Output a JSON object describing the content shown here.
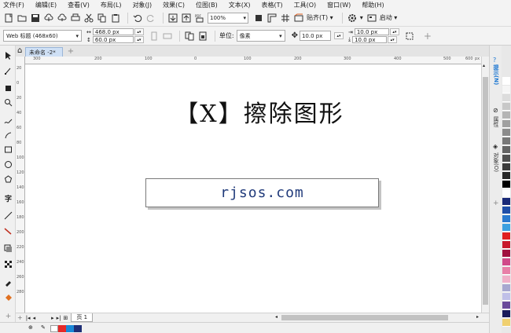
{
  "menu": [
    "文件(F)",
    "编辑(E)",
    "查看(V)",
    "布局(L)",
    "对象(J)",
    "效果(C)",
    "位图(B)",
    "文本(X)",
    "表格(T)",
    "工具(O)",
    "窗口(W)",
    "帮助(H)"
  ],
  "toolbar": {
    "zoom": "100%",
    "snap_label": "贴齐(T)",
    "launch_label": "启动"
  },
  "propbar": {
    "preset": "Web 标题 (468x60)",
    "width": "468.0 px",
    "height": "60.0 px",
    "unit_label": "单位:",
    "unit": "像素",
    "nudge": "10.0 px",
    "dup_x": "10.0 px",
    "dup_y": "10.0 px"
  },
  "tab": {
    "doc_name": "未命名 -2*"
  },
  "ruler": {
    "h_ticks": [
      "300",
      "200",
      "100",
      "0",
      "100",
      "200",
      "300",
      "400",
      "500",
      "600",
      "px"
    ],
    "v_ticks": [
      "20",
      "0",
      "20",
      "40",
      "60",
      "80",
      "100",
      "120",
      "140",
      "160",
      "180",
      "200",
      "220",
      "240",
      "260",
      "280"
    ]
  },
  "canvas": {
    "title": "【X】擦除图形",
    "url": "rjsos.com"
  },
  "pages": {
    "page_label": "页 1"
  },
  "dock": {
    "hints": "提示(N)",
    "properties": "属性",
    "objects": "对象(O)"
  },
  "colors": {
    "accent": "#1e78d2",
    "status_fill_red": "#e52a2a",
    "status_fill_blue": "#1a88d8",
    "status_fill_navy": "#1f2f76",
    "palette": [
      "#ffffff",
      "#f5f5f5",
      "#dcdcdc",
      "#c8c8c8",
      "#b4b4b4",
      "#a0a0a0",
      "#8c8c8c",
      "#787878",
      "#646464",
      "#505050",
      "#3c3c3c",
      "#282828",
      "#000000",
      "#ffffff",
      "#1a2a78",
      "#1f4ea8",
      "#2a7ad0",
      "#3ca0e0",
      "#e02020",
      "#c8182c",
      "#a01040",
      "#d04a8a",
      "#e880a8",
      "#f0b0c8",
      "#a8a8d0",
      "#c0c0e8",
      "#6a4a9a",
      "#1a1a5a",
      "#f0d070"
    ]
  }
}
